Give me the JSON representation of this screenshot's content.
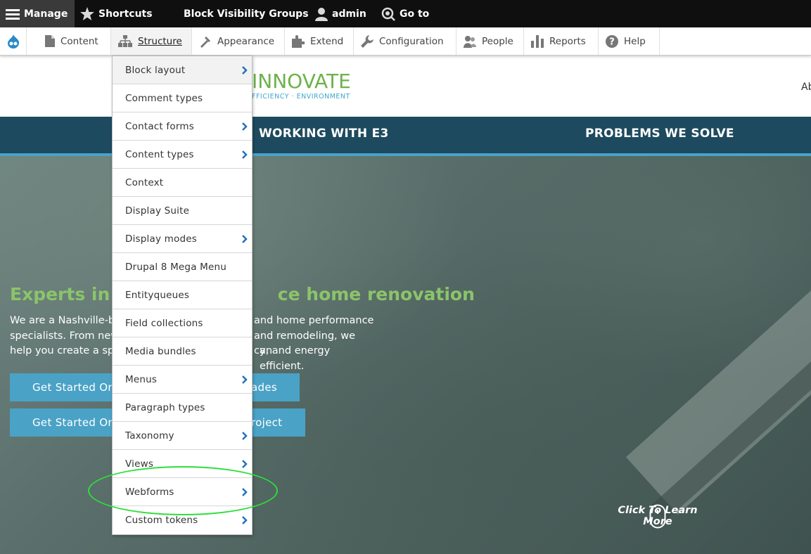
{
  "admin_bar": {
    "manage": "Manage",
    "shortcuts": "Shortcuts",
    "block_visibility": "Block Visibility Groups",
    "user": "admin",
    "goto": "Go to"
  },
  "tray": {
    "items": [
      "Content",
      "Structure",
      "Appearance",
      "Extend",
      "Configuration",
      "People",
      "Reports",
      "Help"
    ]
  },
  "site": {
    "brand_main": "INNOVATE",
    "brand_sub": "FFICIENCY · ENVIRONMENT",
    "header_cut": "Ab",
    "nav": [
      "WORKING WITH E3",
      "PROBLEMS WE SOLVE"
    ]
  },
  "hero": {
    "title_left": "Experts in h",
    "title_right": "ce home renovation",
    "desc_lines": [
      [
        "We are a Nashville-ba",
        "and home performance"
      ],
      [
        "specialists. From new",
        "and remodeling, we can"
      ],
      [
        "help you create a spac",
        "y, and energy efficient."
      ]
    ],
    "btn1_left": "Get Started On",
    "btn1_right": "ades",
    "btn2_left": "Get Started On",
    "btn2_right": "roject",
    "learn_more": "Click To Learn More"
  },
  "dropdown": {
    "items": [
      {
        "label": "Block layout",
        "arrow": true
      },
      {
        "label": "Comment types",
        "arrow": false
      },
      {
        "label": "Contact forms",
        "arrow": true
      },
      {
        "label": "Content types",
        "arrow": true
      },
      {
        "label": "Context",
        "arrow": false
      },
      {
        "label": "Display Suite",
        "arrow": false
      },
      {
        "label": "Display modes",
        "arrow": true
      },
      {
        "label": "Drupal 8 Mega Menu",
        "arrow": false
      },
      {
        "label": "Entityqueues",
        "arrow": false
      },
      {
        "label": "Field collections",
        "arrow": false
      },
      {
        "label": "Media bundles",
        "arrow": false
      },
      {
        "label": "Menus",
        "arrow": true
      },
      {
        "label": "Paragraph types",
        "arrow": false
      },
      {
        "label": "Taxonomy",
        "arrow": true
      },
      {
        "label": "Views",
        "arrow": true
      },
      {
        "label": "Webforms",
        "arrow": true
      },
      {
        "label": "Custom tokens",
        "arrow": true
      }
    ]
  },
  "colors": {
    "highlight": "#2ddf3a",
    "nav_bg": "#1d4a5e",
    "accent": "#4aa2c6",
    "title_green": "#8bc46a"
  },
  "icons": [
    "hamburger-icon",
    "star-icon",
    "user-icon",
    "goto-icon",
    "drupal-icon",
    "content-icon",
    "structure-icon",
    "appearance-icon",
    "extend-icon",
    "configuration-icon",
    "people-icon",
    "reports-icon",
    "help-icon",
    "chevron-right-icon",
    "mouse-icon"
  ]
}
